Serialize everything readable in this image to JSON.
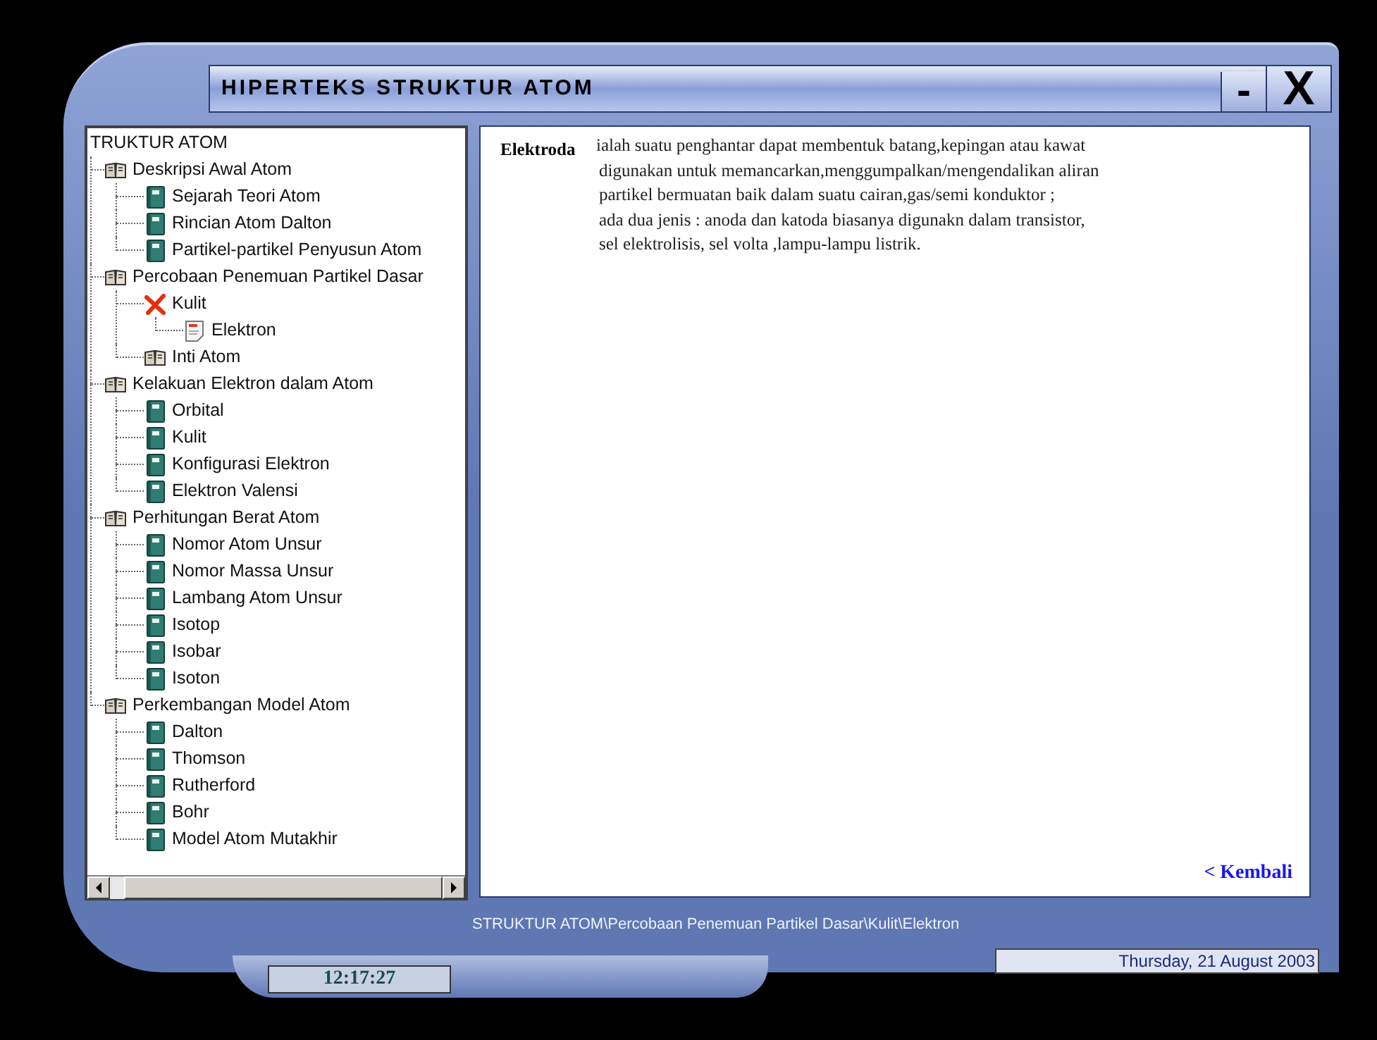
{
  "window": {
    "title": "HIPERTEKS STRUKTUR ATOM",
    "controls": [
      "-",
      "X"
    ]
  },
  "tree": {
    "root": "TRUKTUR ATOM",
    "items": [
      {
        "label": "Deskripsi Awal Atom",
        "kind": "book",
        "children": [
          {
            "label": "Sejarah Teori Atom",
            "kind": "page"
          },
          {
            "label": "Rincian Atom Dalton",
            "kind": "page"
          },
          {
            "label": "Partikel-partikel Penyusun Atom",
            "kind": "page"
          }
        ]
      },
      {
        "label": "Percobaan Penemuan Partikel Dasar",
        "kind": "book",
        "children": [
          {
            "label": "Kulit",
            "kind": "cross",
            "children": [
              {
                "label": "Elektron",
                "kind": "note"
              }
            ]
          },
          {
            "label": "Inti Atom",
            "kind": "book"
          }
        ]
      },
      {
        "label": "Kelakuan Elektron dalam Atom",
        "kind": "book",
        "children": [
          {
            "label": "Orbital",
            "kind": "page"
          },
          {
            "label": "Kulit",
            "kind": "page"
          },
          {
            "label": "Konfigurasi Elektron",
            "kind": "page"
          },
          {
            "label": "Elektron Valensi",
            "kind": "page"
          }
        ]
      },
      {
        "label": "Perhitungan Berat Atom",
        "kind": "book",
        "children": [
          {
            "label": "Nomor Atom Unsur",
            "kind": "page"
          },
          {
            "label": "Nomor Massa Unsur",
            "kind": "page"
          },
          {
            "label": "Lambang Atom Unsur",
            "kind": "page"
          },
          {
            "label": "Isotop",
            "kind": "page"
          },
          {
            "label": "Isobar",
            "kind": "page"
          },
          {
            "label": "Isoton",
            "kind": "page"
          }
        ]
      },
      {
        "label": "Perkembangan Model Atom",
        "kind": "book",
        "children": [
          {
            "label": "Dalton",
            "kind": "page"
          },
          {
            "label": "Thomson",
            "kind": "page"
          },
          {
            "label": "Rutherford",
            "kind": "page"
          },
          {
            "label": "Bohr",
            "kind": "page"
          },
          {
            "label": "Model Atom Mutakhir",
            "kind": "page"
          }
        ]
      }
    ]
  },
  "content": {
    "term": "Elektroda",
    "lines": [
      "ialah suatu penghantar dapat membentuk batang,kepingan atau kawat",
      "digunakan untuk memancarkan,menggumpalkan/mengendalikan aliran",
      "partikel bermuatan baik dalam suatu cairan,gas/semi konduktor ;",
      "ada dua jenis : anoda dan katoda biasanya digunakn dalam transistor,",
      "sel elektrolisis, sel volta ,lampu-lampu listrik."
    ],
    "back_link": "< Kembali"
  },
  "path": "STRUKTUR ATOM\\Percobaan Penemuan Partikel Dasar\\Kulit\\Elektron",
  "date": "Thursday, 21 August 2003",
  "clock": "12:17:27"
}
